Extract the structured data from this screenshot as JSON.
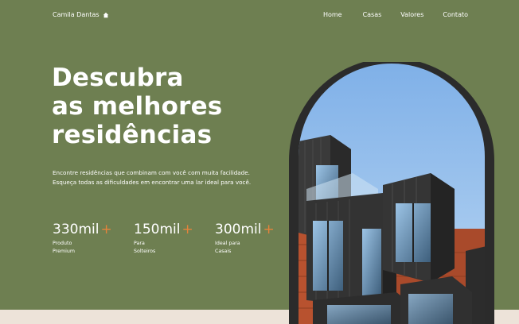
{
  "header": {
    "brand": "Camila Dantas",
    "nav": [
      {
        "label": "Home"
      },
      {
        "label": "Casas"
      },
      {
        "label": "Valores"
      },
      {
        "label": "Contato"
      }
    ]
  },
  "hero": {
    "title_lines": [
      "Descubra",
      "as melhores",
      "residências"
    ],
    "description": "Encontre residências que combinam com você com muita facilidade. Esqueça todas as dificuldades em encontrar uma lar ideal para você.",
    "stats": [
      {
        "value": "330mil",
        "plus": "+",
        "label_lines": [
          "Produto",
          "Premium"
        ]
      },
      {
        "value": "150mil",
        "plus": "+",
        "label_lines": [
          "Para",
          "Solteiros"
        ]
      },
      {
        "value": "300mil",
        "plus": "+",
        "label_lines": [
          "Ideal para",
          "Casais"
        ]
      }
    ]
  },
  "colors": {
    "background": "#6e7f51",
    "accent": "#e5833b",
    "arch_frame": "#2b2b2b",
    "bottom_band": "#ede3d9"
  },
  "icons": {
    "brand": "house-icon"
  },
  "image": {
    "name": "building-photo"
  }
}
